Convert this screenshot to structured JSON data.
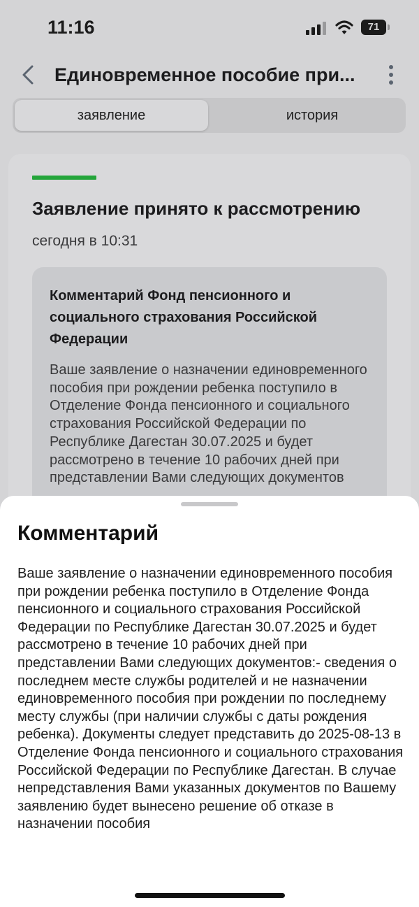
{
  "status_bar": {
    "time": "11:16",
    "battery": "71"
  },
  "navbar": {
    "title": "Единовременное пособие при..."
  },
  "tabs": [
    {
      "label": "заявление",
      "active": true
    },
    {
      "label": "история",
      "active": false
    }
  ],
  "card": {
    "status_color": "#24a53a",
    "title": "Заявление принято к рассмотрению",
    "date": "сегодня в 10:31",
    "comment_heading": "Комментарий Фонд пенсионного и социального страхования Российской Федерации",
    "comment_text": "Ваше заявление о назначении единовременного пособия при рождении ребенка поступило в Отделение Фонда пенсионного и социального страхования Российской Федерации по Республике Дагестан 30.07.2025 и будет рассмотрено в течение 10 рабочих дней при представлении Вами следующих документов"
  },
  "sheet": {
    "title": "Комментарий",
    "text": "Ваше заявление о назначении единовременного пособия при рождении ребенка поступило в Отделение Фонда пенсионного и социального страхования Российской Федерации по Республике Дагестан 30.07.2025 и будет рассмотрено в течение 10 рабочих дней при представлении Вами следующих документов:- сведения о последнем месте службы родителей и не назначении единовременного пособия при рождении по последнему месту службы (при наличии службы с даты рождения ребенка). Документы следует представить до 2025-08-13 в Отделение Фонда пенсионного и социального страхования Российской Федерации по Республике Дагестан. В случае непредставления Вами указанных документов по Вашему заявлению будет вынесено решение об отказе в назначении пособия"
  }
}
